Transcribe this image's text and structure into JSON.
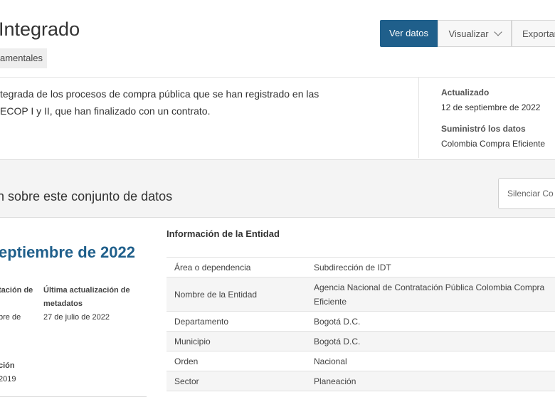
{
  "header": {
    "title": "Integrado",
    "tag": "amentales",
    "buttons": {
      "ver_datos": "Ver datos",
      "visualizar": "Visualizar",
      "exportar": "Exportar"
    }
  },
  "description": {
    "line1": "tegrada de los procesos de compra pública que se han registrado en las",
    "line2": "ECOP I y II, que han finalizado con un contrato."
  },
  "sidebar_meta": {
    "updated_label": "Actualizado",
    "updated_value": "12 de septiembre de 2022",
    "provider_label": "Suministró los datos",
    "provider_value": "Colombia Compra Eficiente"
  },
  "about": {
    "title": "n sobre este conjunto de datos",
    "silence_button": "Silenciar Co"
  },
  "left": {
    "big_date": "eptiembre de 2022",
    "col1_label_1": "tación de",
    "col1_value_1": "bre de",
    "col2_label_1": "Última actualización de",
    "col2_label_2": "metadatos",
    "col2_value": "27 de julio de 2022",
    "creation_label": "ción",
    "creation_value": "2019"
  },
  "entity": {
    "title": "Información de la Entidad",
    "rows": [
      {
        "key": "Área o dependencia",
        "value": "Subdirección de IDT"
      },
      {
        "key": "Nombre de la Entidad",
        "value": "Agencia Nacional de Contratación Pública Colombia Compra Eficiente"
      },
      {
        "key": "Departamento",
        "value": "Bogotá D.C."
      },
      {
        "key": "Municipio",
        "value": "Bogotá D.C."
      },
      {
        "key": "Orden",
        "value": "Nacional"
      },
      {
        "key": "Sector",
        "value": "Planeación"
      }
    ]
  },
  "colors": {
    "accent": "#1f5f8b",
    "band": "#f4f4f4"
  },
  "icons": {
    "dropdown": "chevron-down-icon"
  }
}
